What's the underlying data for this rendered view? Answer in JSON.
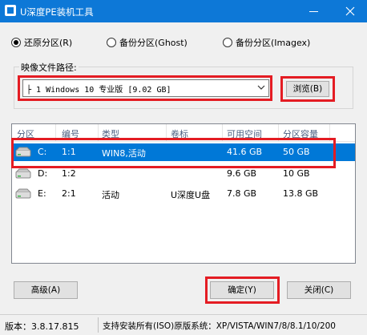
{
  "window": {
    "title": "U深度PE装机工具"
  },
  "radios": [
    {
      "label": "还原分区(R)",
      "checked": true
    },
    {
      "label": "备份分区(Ghost)",
      "checked": false
    },
    {
      "label": "备份分区(Imagex)",
      "checked": false
    }
  ],
  "image_path": {
    "label": "映像文件路径:",
    "value": "├ 1 Windows 10 专业版 [9.02 GB]",
    "browse_label": "浏览(B)"
  },
  "table": {
    "columns": [
      "分区",
      "编号",
      "类型",
      "卷标",
      "可用空间",
      "分区容量"
    ],
    "rows": [
      {
        "drive": "C:",
        "number": "1:1",
        "type": "WIN8,活动",
        "label": "",
        "free": "41.6 GB",
        "capacity": "50 GB",
        "selected": true
      },
      {
        "drive": "D:",
        "number": "1:2",
        "type": "",
        "label": "",
        "free": "9.6 GB",
        "capacity": "10 GB",
        "selected": false
      },
      {
        "drive": "E:",
        "number": "2:1",
        "type": "活动",
        "label": "U深度U盘",
        "free": "7.8 GB",
        "capacity": "13.8 GB",
        "selected": false
      }
    ]
  },
  "buttons": {
    "advanced": "高级(A)",
    "ok": "确定(Y)",
    "close": "关闭(C)"
  },
  "status": {
    "version": "版本：3.8.17.815",
    "support": "支持安装所有(ISO)原版系统：XP/VISTA/WIN7/8/8.1/10/200"
  },
  "colors": {
    "titlebar": "#0d78d7",
    "selection": "#0078d7",
    "highlight": "#e41c23"
  }
}
